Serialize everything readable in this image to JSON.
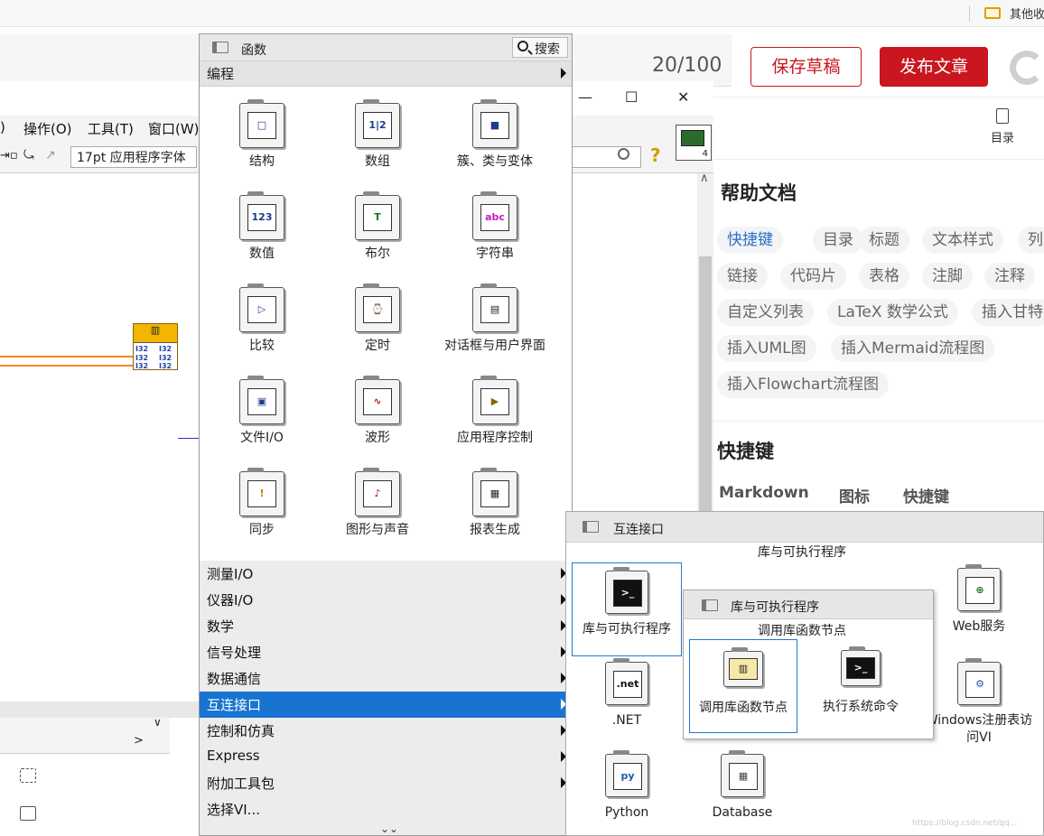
{
  "browser": {
    "bookmark_label": "其他收"
  },
  "editor": {
    "word_count": "20/100",
    "save_draft_label": "保存草稿",
    "publish_label": "发布文章"
  },
  "help_panel": {
    "toc_label": "目录",
    "title": "帮助文档",
    "chips": [
      "快捷键",
      "目录",
      "标题",
      "文本样式",
      "列",
      "链接",
      "代码片",
      "表格",
      "注脚",
      "注释",
      "自定义列表",
      "LaTeX 数学公式",
      "插入甘特",
      "插入UML图",
      "插入Mermaid流程图",
      "插入Flowchart流程图"
    ],
    "shortcut_title": "快捷键",
    "columns": [
      "Markdown",
      "图标",
      "快捷键"
    ]
  },
  "diagram_window": {
    "menus": [
      "操作(O)",
      "工具(T)",
      "窗口(W)"
    ],
    "menu_partial": ")",
    "font_selector": "17pt 应用程序字体",
    "window_controls": {
      "maximize": "☐",
      "close": "✕"
    },
    "help_icon": "question-icon"
  },
  "functions_palette": {
    "title": "函数",
    "search_label": "搜索",
    "category": "编程",
    "items": [
      {
        "label": "结构",
        "glyph": "□"
      },
      {
        "label": "数组",
        "glyph": "1|2"
      },
      {
        "label": "簇、类与变体",
        "glyph": "■"
      },
      {
        "label": "数值",
        "glyph": "123"
      },
      {
        "label": "布尔",
        "glyph": "T"
      },
      {
        "label": "字符串",
        "glyph": "abc"
      },
      {
        "label": "比较",
        "glyph": "▷"
      },
      {
        "label": "定时",
        "glyph": "⌚"
      },
      {
        "label": "对话框与用户界面",
        "glyph": "▤"
      },
      {
        "label": "文件I/O",
        "glyph": "▣"
      },
      {
        "label": "波形",
        "glyph": "∿"
      },
      {
        "label": "应用程序控制",
        "glyph": "▶"
      },
      {
        "label": "同步",
        "glyph": "!"
      },
      {
        "label": "图形与声音",
        "glyph": "♪"
      },
      {
        "label": "报表生成",
        "glyph": "▦"
      }
    ],
    "list": [
      "测量I/O",
      "仪器I/O",
      "数学",
      "信号处理",
      "数据通信",
      "互连接口",
      "控制和仿真",
      "Express",
      "附加工具包",
      "选择VI..."
    ],
    "selected_list_item": "互连接口",
    "more_glyph": "⌄⌄"
  },
  "connectivity_palette": {
    "title": "互连接口",
    "subtitle": "库与可执行程序",
    "items": [
      {
        "label": "库与可执行程序",
        "glyph": ">_"
      },
      {
        "label": ".NET",
        "glyph": ".net"
      },
      {
        "label": "Python",
        "glyph": "py"
      },
      {
        "label": "Database",
        "glyph": "▦"
      },
      {
        "label": "Web服务",
        "glyph": "⊕"
      },
      {
        "label": "Windows注册表访问VI",
        "glyph": "⚙"
      }
    ]
  },
  "libraries_palette": {
    "title": "库与可执行程序",
    "subtitle": "调用库函数节点",
    "items": [
      {
        "label": "调用库函数节点",
        "glyph": "▥"
      },
      {
        "label": "执行系统命令",
        "glyph": ">_"
      }
    ]
  },
  "watermark": "https://blog.csdn.net/qq..."
}
